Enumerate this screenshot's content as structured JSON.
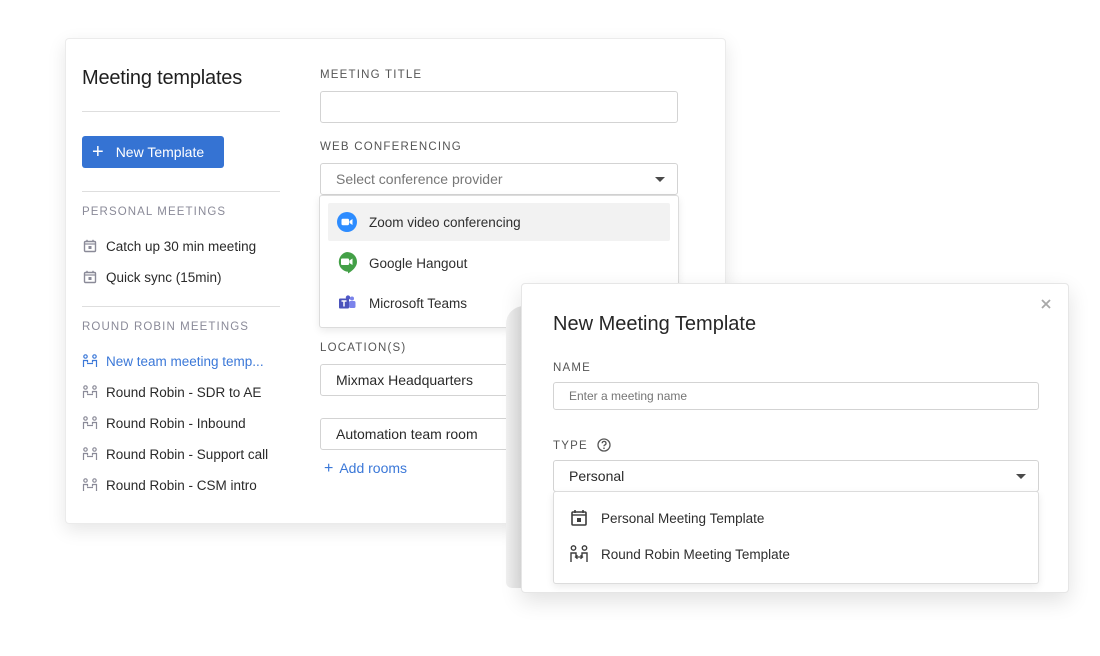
{
  "sidebar": {
    "title": "Meeting templates",
    "new_template_label": "New Template",
    "new_template_icon": "plus-icon",
    "sections": [
      {
        "label": "PERSONAL MEETINGS",
        "items": [
          {
            "label": "Catch up 30 min meeting",
            "icon": "calendar-icon"
          },
          {
            "label": "Quick sync (15min)",
            "icon": "calendar-icon"
          }
        ]
      },
      {
        "label": "ROUND ROBIN MEETINGS",
        "items": [
          {
            "label": "New team meeting temp...",
            "icon": "round-robin-icon",
            "active": true
          },
          {
            "label": "Round Robin - SDR to AE",
            "icon": "round-robin-icon"
          },
          {
            "label": "Round Robin - Inbound",
            "icon": "round-robin-icon"
          },
          {
            "label": "Round Robin - Support call",
            "icon": "round-robin-icon"
          },
          {
            "label": "Round Robin - CSM intro",
            "icon": "round-robin-icon"
          }
        ]
      }
    ]
  },
  "form": {
    "meeting_title": {
      "label": "MEETING TITLE",
      "value": ""
    },
    "web_conferencing": {
      "label": "WEB CONFERENCING",
      "placeholder": "Select conference provider",
      "options": [
        {
          "label": "Zoom video conferencing",
          "icon": "zoom-icon",
          "highlighted": true
        },
        {
          "label": "Google Hangout",
          "icon": "google-hangouts-icon"
        },
        {
          "label": "Microsoft Teams",
          "icon": "microsoft-teams-icon"
        }
      ]
    },
    "locations": {
      "label": "LOCATION(S)",
      "values": [
        "Mixmax Headquarters",
        "Automation team room"
      ],
      "add_label": "Add rooms"
    }
  },
  "modal": {
    "title": "New Meeting Template",
    "close_icon": "close-icon",
    "name": {
      "label": "NAME",
      "placeholder": "Enter a meeting name",
      "value": ""
    },
    "type": {
      "label": "TYPE",
      "help_icon": "help-circle-icon",
      "selected": "Personal",
      "options": [
        {
          "label": "Personal Meeting Template",
          "icon": "calendar-icon"
        },
        {
          "label": "Round Robin Meeting Template",
          "icon": "round-robin-icon"
        }
      ]
    }
  },
  "colors": {
    "primary": "#3573d3",
    "link": "#3b78d8",
    "zoom": "#2d8cff",
    "hangouts": "#43a047",
    "teams": "#5059c9"
  }
}
